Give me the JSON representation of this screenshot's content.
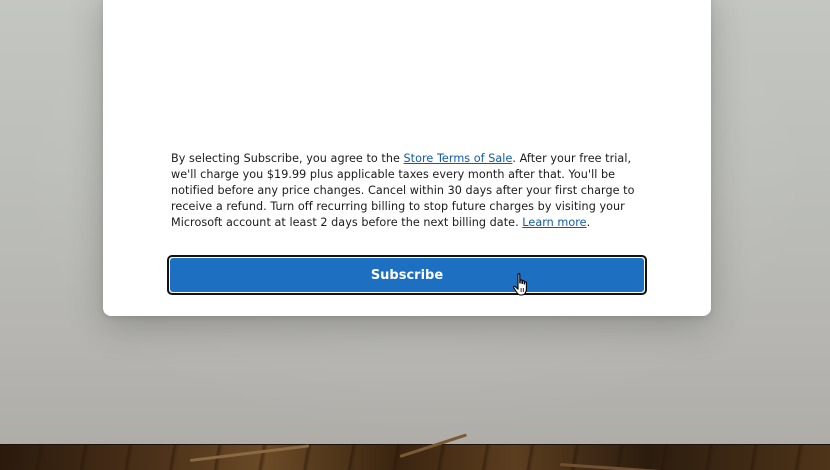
{
  "dialog": {
    "terms": {
      "intro": "By selecting Subscribe, you agree to the ",
      "store_terms_link": "Store Terms of Sale",
      "body": ". After your free trial, we'll charge you $19.99 plus applicable taxes every month after that. You'll be notified before any price changes. Cancel within 30 days after your first charge to receive a refund. Turn off recurring billing to stop future charges by visiting your Microsoft account at least 2 days before the next billing date. ",
      "learn_more_link": "Learn more",
      "end": "."
    },
    "subscribe_label": "Subscribe"
  },
  "colors": {
    "accent": "#1d6fc1",
    "link": "#0f5aa8"
  },
  "icons": {
    "cursor": "hand-pointer-icon"
  }
}
